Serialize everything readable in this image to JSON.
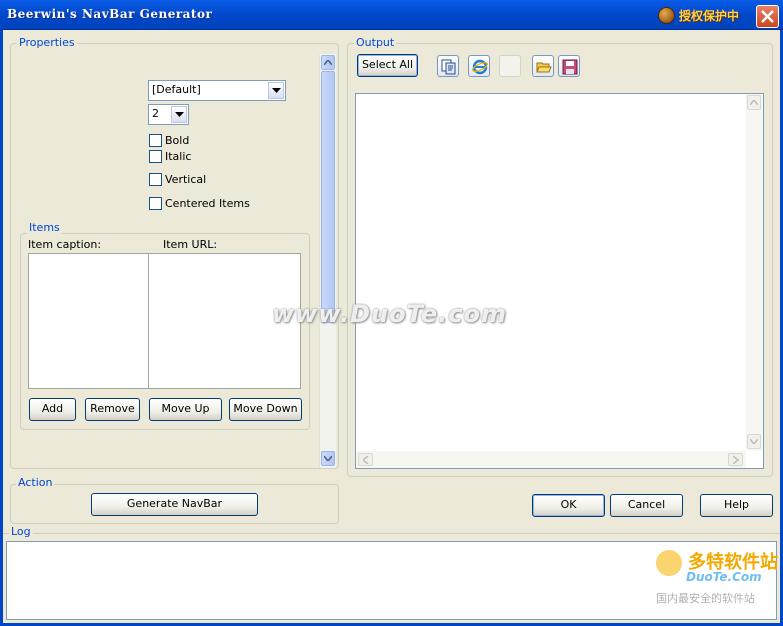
{
  "window": {
    "title": "Beerwin's NavBar Generator",
    "badge_text": "授权保护中"
  },
  "properties": {
    "group_label": "Properties",
    "font_select": "[Default]",
    "size_select": "2",
    "bold_label": "Bold",
    "italic_label": "Italic",
    "vertical_label": "Vertical",
    "centered_label": "Centered Items"
  },
  "items": {
    "group_label": "Items",
    "caption_header": "Item caption:",
    "url_header": "Item URL:",
    "add_label": "Add",
    "remove_label": "Remove",
    "move_up_label": "Move Up",
    "move_down_label": "Move Down"
  },
  "output": {
    "group_label": "Output",
    "select_all_label": "Select All"
  },
  "action": {
    "group_label": "Action",
    "generate_label": "Generate NavBar"
  },
  "dialog": {
    "ok_label": "OK",
    "cancel_label": "Cancel",
    "help_label": "Help"
  },
  "log": {
    "group_label": "Log"
  },
  "watermarks": {
    "center": "www.DuoTe.com",
    "corner_big": "多特软件站",
    "corner_site": "DuoTe.Com",
    "corner_tagline": "国内最安全的软件站"
  },
  "icons": {
    "copy": "copy-icon",
    "browser": "ie-browser-icon",
    "open": "open-folder-icon",
    "save": "save-disk-icon",
    "close": "close-icon"
  },
  "colors": {
    "titlebar": "#0047C8",
    "group_label": "#0046D5",
    "close": "#C8471F",
    "face": "#ECE9D8"
  }
}
